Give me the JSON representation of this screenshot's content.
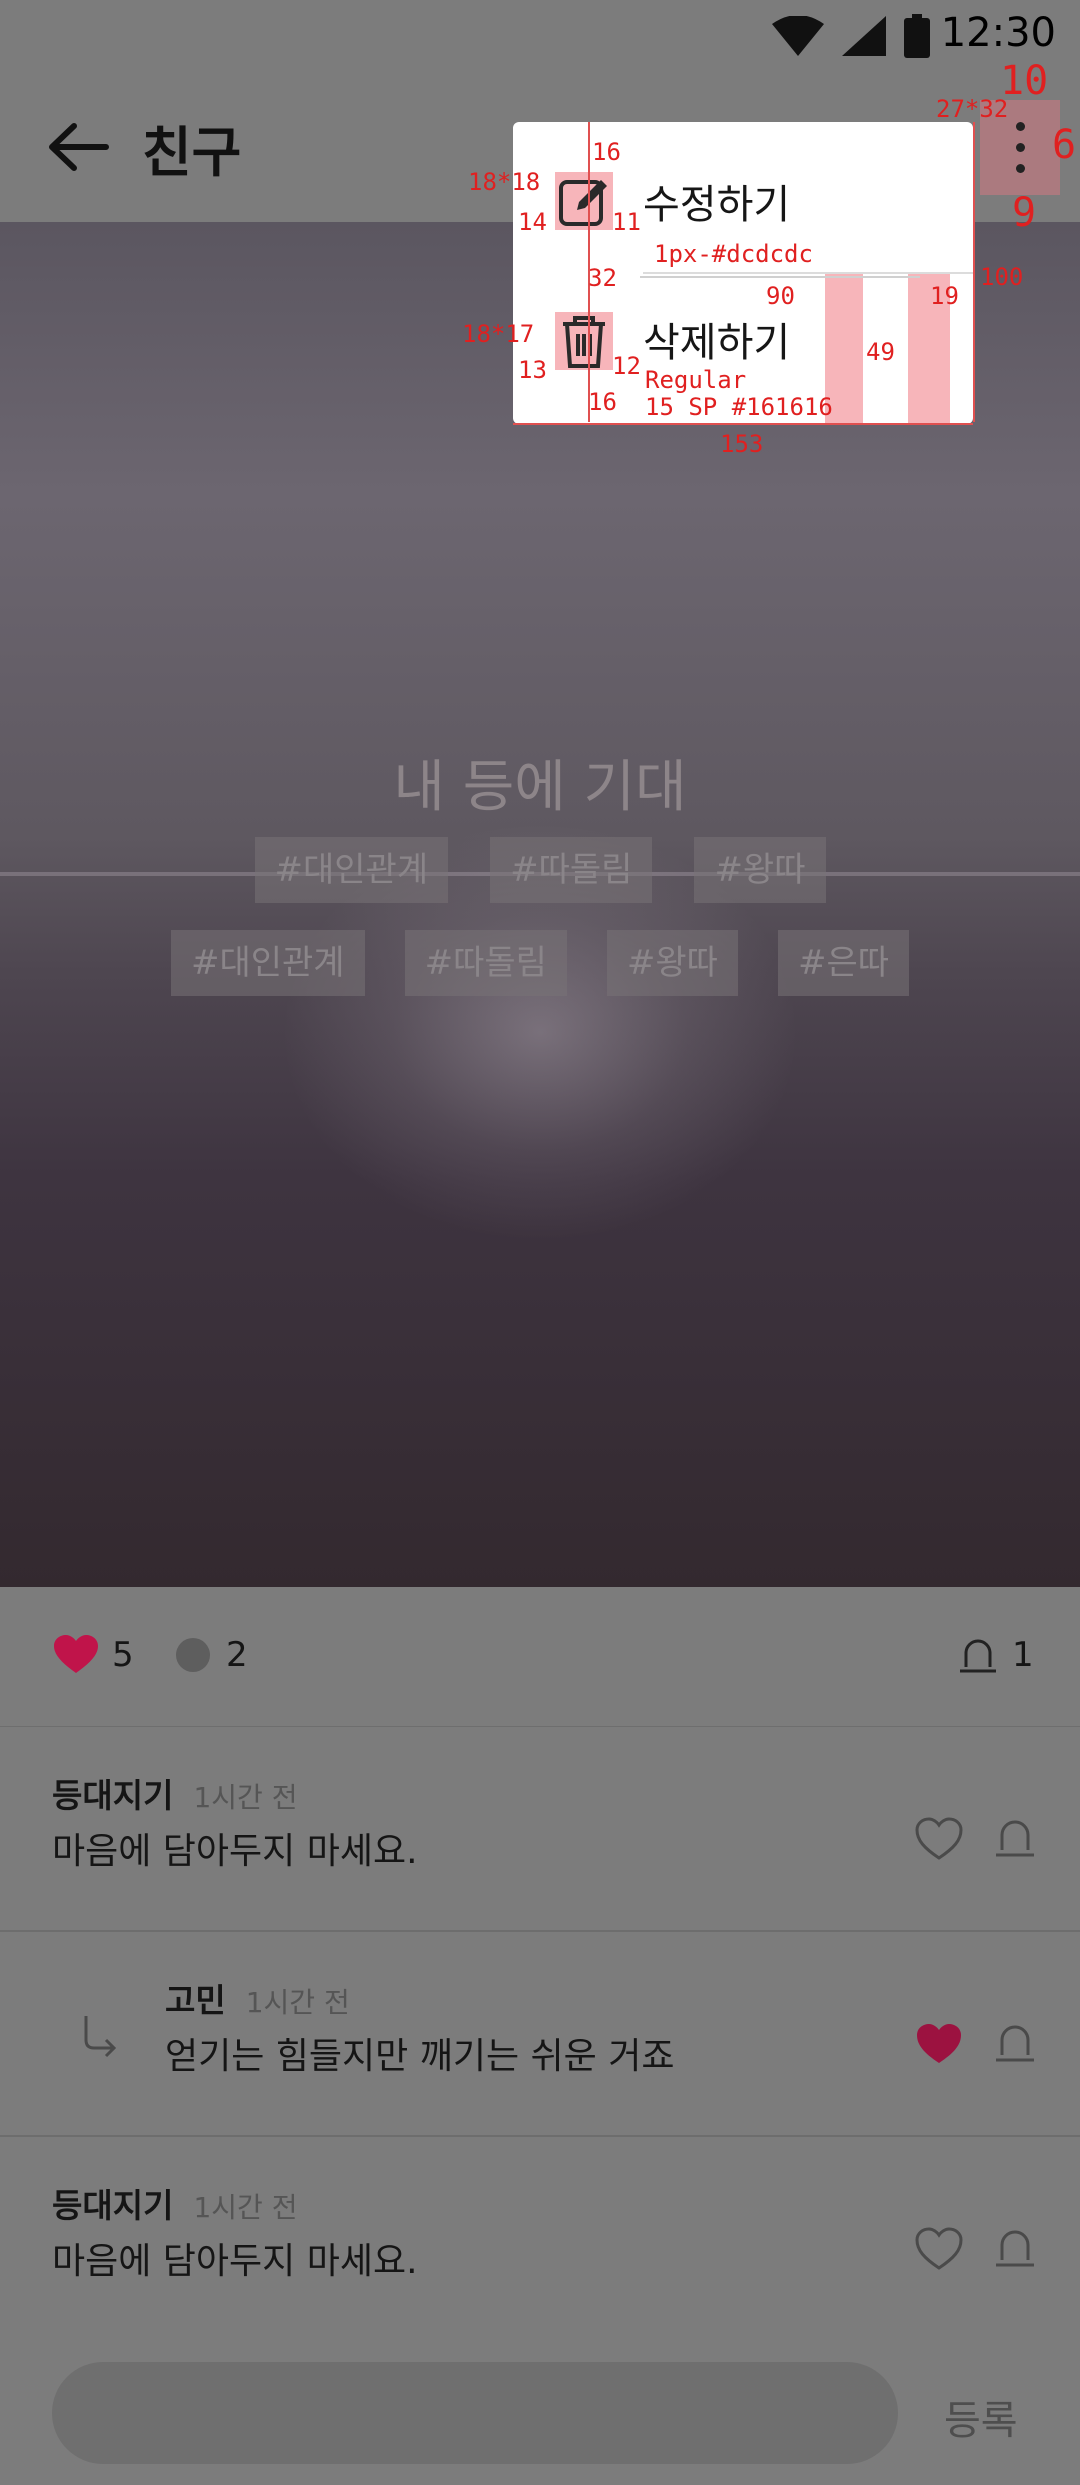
{
  "status_bar": {
    "time": "12:30"
  },
  "app_bar": {
    "title": "친구"
  },
  "hero": {
    "title": "내 등에 기대",
    "tags_row1": [
      "#대인관계",
      "#따돌림",
      "#왕따"
    ],
    "tags_row2": [
      "#대인관계",
      "#따돌림",
      "#왕따",
      "#은따"
    ]
  },
  "stats": {
    "likes": "5",
    "comments": "2",
    "reports": "1"
  },
  "comments": [
    {
      "author": "등대지기",
      "time": "1시간 전",
      "text": "마음에 담아두지 마세요.",
      "liked": false
    },
    {
      "author": "고민",
      "time": "1시간 전",
      "text": "얻기는 힘들지만 깨기는 쉬운 거죠",
      "liked": true,
      "reply": true
    },
    {
      "author": "등대지기",
      "time": "1시간 전",
      "text": "마음에 담아두지 마세요.",
      "liked": false
    }
  ],
  "input": {
    "submit_label": "등록"
  },
  "menu": {
    "edit_label": "수정하기",
    "delete_label": "삭제하기"
  },
  "annotations": {
    "more_size": "27*32",
    "more_top": "10",
    "more_right": "6",
    "more_bottom": "9",
    "edit_icon_size": "18*18",
    "delete_icon_size": "18*17",
    "pad_top": "16",
    "edit_icon_left": "14",
    "edit_icon_gap": "11",
    "item_gap": "32",
    "divider_spec": "1px-#dcdcdc",
    "divider_width": "90",
    "menu_right_gap": "19",
    "menu_right_offset": "100",
    "delete_icon_left": "13",
    "delete_icon_gap": "12",
    "pad_bottom": "16",
    "font_spec_1": "Regular",
    "font_spec_2": "15 SP #161616",
    "item_height": "49",
    "menu_width": "153"
  },
  "colors": {
    "accent": "#c0144a",
    "divider": "#dcdcdc",
    "text": "#161616"
  }
}
